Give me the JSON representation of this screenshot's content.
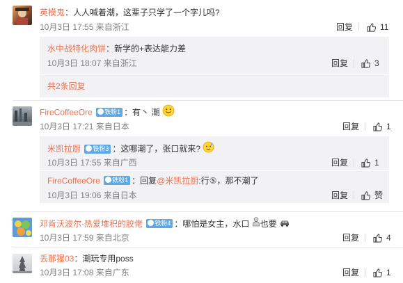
{
  "comments": [
    {
      "username": "英模鬼",
      "text": "：人人喊着潮，这辈子只学了一个字儿吗?",
      "time": "10月3日 17:55 来自浙江",
      "reply_label": "回复",
      "likes": "11",
      "replies": [
        {
          "username": "水中战特化肉饼",
          "text": "：新学的+表达能力差",
          "time": "10月3日 18:07 来自浙江",
          "reply_label": "回复",
          "likes": "3"
        }
      ],
      "more_replies": "共2条回复"
    },
    {
      "username": "FireCoffeeOre",
      "badge": "铁粉1",
      "text": "：有丶 潮",
      "time": "10月3日 17:21 来自日本",
      "reply_label": "回复",
      "likes": "1",
      "replies": [
        {
          "username": "米凯拉厨",
          "badge": "铁粉3",
          "text": "：这哪潮了，张口就来?",
          "time": "10月3日 17:55 来自广西",
          "reply_label": "回复",
          "likes": "1"
        },
        {
          "username": "FireCoffeeOre",
          "badge": "铁粉1",
          "text_prefix": "：回复",
          "mention": "@米凯拉厨",
          "text_suffix": ":行⑤，那不潮了",
          "time": "10月3日 19:06 来自日本",
          "reply_label": "回复",
          "likes": "赞"
        }
      ]
    },
    {
      "username": "邓肯沃波尔-热爱堆积的胶佬",
      "badge": "铁粉4",
      "text": "：哪怕是女主，水口",
      "text_suffix": "也要",
      "time": "10月3日 17:59 来自北京",
      "reply_label": "回复",
      "likes": "4"
    },
    {
      "username": "丢那猩03",
      "text": "：潮玩专用poss",
      "time": "10月3日 17:08 来自广东",
      "reply_label": "回复",
      "likes": "1"
    }
  ],
  "colors": {
    "username": "#eb7350",
    "meta": "#808080",
    "sub_background": "#f2f2f5",
    "badge": "#5fa8e3"
  },
  "icons": [
    "thumbs-up-icon",
    "fan-badge-icon",
    "smile-emoji-icon",
    "sweat-emoji-icon"
  ]
}
